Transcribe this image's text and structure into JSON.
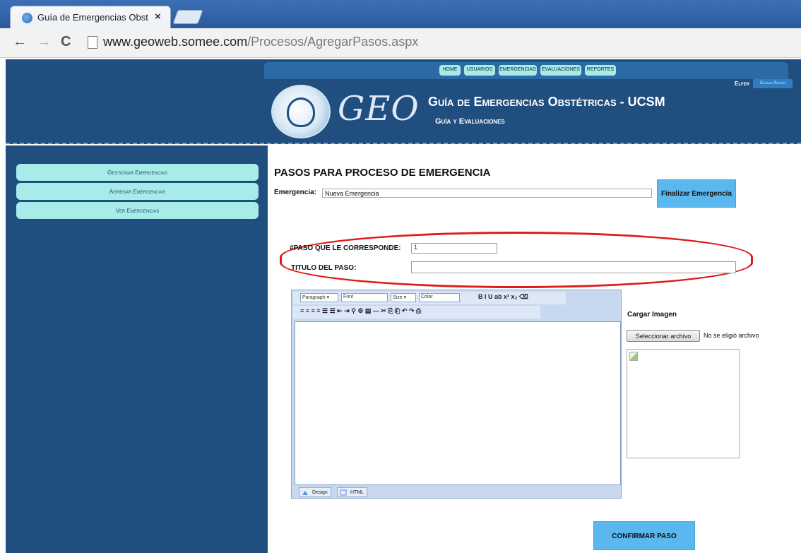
{
  "browser": {
    "tab_title": "Guía de Emergencias Obst",
    "tab_close": "×",
    "url_host": "www.geoweb.somee.com",
    "url_path": "/Procesos/AgregarPasos.aspx",
    "back_glyph": "←",
    "forward_glyph": "→",
    "reload_glyph": "C"
  },
  "topnav": {
    "items": [
      "Home",
      "Usuarios",
      "Emergencias",
      "Evaluaciones",
      "Reportes"
    ]
  },
  "header": {
    "logo_text": "GEO",
    "title": "Guía de Emergencias Obstétricas - UCSM",
    "subtitle": "Guía y Evaluaciones",
    "user_name": "Elfer",
    "logout_label": "Cerrar Sesión"
  },
  "sidebar": {
    "items": [
      "Gestionar Emergencias",
      "Agregar Emergencias",
      "Ver Emergencias"
    ]
  },
  "main": {
    "title": "PASOS PARA PROCESO DE EMERGENCIA",
    "emergency_label": "Emergencia:",
    "emergency_value": "Nueva Emergencia",
    "finalize_label": "Finalizar Emergencia",
    "step_number_label": "#PASO QUE LE CORRESPONDE:",
    "step_number_value": "1",
    "step_title_label": "TITULO DEL PASO:",
    "step_title_value": "",
    "highlight_color": "#e01b1b",
    "confirm_label": "CONFIRMAR PASO"
  },
  "editor": {
    "paragraph_select": "Paragraph ▾",
    "font_select": "Font",
    "size_select": "Size ▾",
    "color_select": "Color",
    "format_glyphs": "B  I  U  ab  x²  x₂  ⌫",
    "row2_glyphs": "≡ ≡ ≡ ≡  ☰ ☰ ⇤ ⇥  ⚲ ⚙ ▤ ―   ✂ ⎘ ⎗  ↶ ↷ ⎙",
    "tab_design": "Design",
    "tab_html": "HTML"
  },
  "upload": {
    "label": "Cargar Imagen",
    "button_label": "Seleccionar archivo",
    "status_text": "No se eligió archivo"
  }
}
